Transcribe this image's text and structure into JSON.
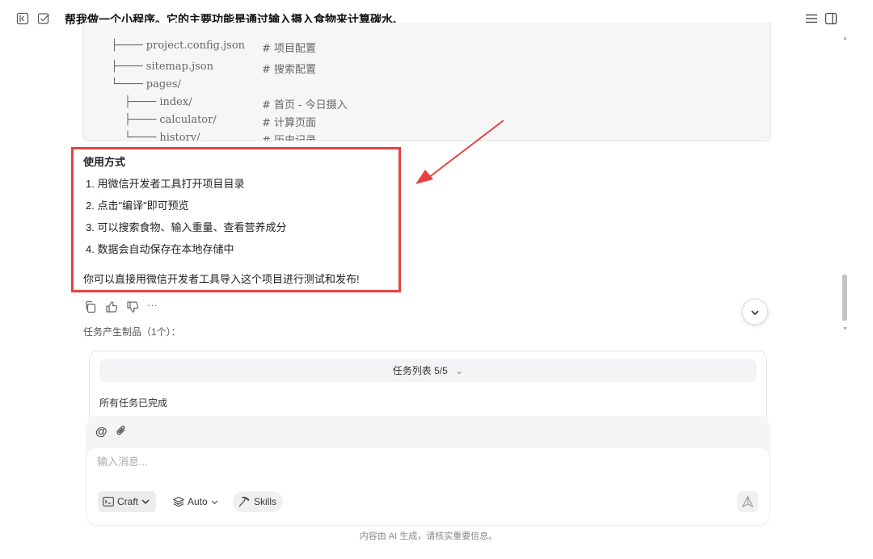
{
  "header": {
    "title": "帮我做一个小程序。它的主要功能是通过输入摄入食物来计算碳水、",
    "icons": [
      "collapse-sidebar-icon",
      "checkbox-icon",
      "menu-icon",
      "split-panel-icon"
    ]
  },
  "code_block": {
    "lines": [
      {
        "tree": "├──── project.config.json",
        "comment": "# 项目配置"
      },
      {
        "tree": "├──── sitemap.json",
        "comment": "# 搜索配置"
      },
      {
        "tree": "└──── pages/",
        "comment": ""
      },
      {
        "tree": "    ├──── index/",
        "comment": "# 首页 - 今日摄入"
      },
      {
        "tree": "    ├──── calculator/",
        "comment": "# 计算页面"
      },
      {
        "tree": "    └──── history/",
        "comment": "# 历史记录"
      }
    ]
  },
  "usage": {
    "title": "使用方式",
    "steps": [
      "1. 用微信开发者工具打开项目目录",
      "2. 点击\"编译\"即可预览",
      "3. 可以搜索食物、输入重量、查看营养成分",
      "4. 数据会自动保存在本地存储中"
    ],
    "note": "你可以直接用微信开发者工具导入这个项目进行测试和发布!"
  },
  "artifacts": {
    "label": "任务产生制品（1个）：",
    "task_list_label": "任务列表 5/5",
    "status": "所有任务已完成"
  },
  "composer": {
    "placeholder": "输入消息...",
    "craft_label": "Craft",
    "auto_label": "Auto",
    "skills_label": "Skills"
  },
  "footer": {
    "disclaimer": "内容由 AI 生成，请核实重要信息。"
  },
  "colors": {
    "annotation_red": "#e8413f",
    "code_bg": "#f6f6f7"
  }
}
